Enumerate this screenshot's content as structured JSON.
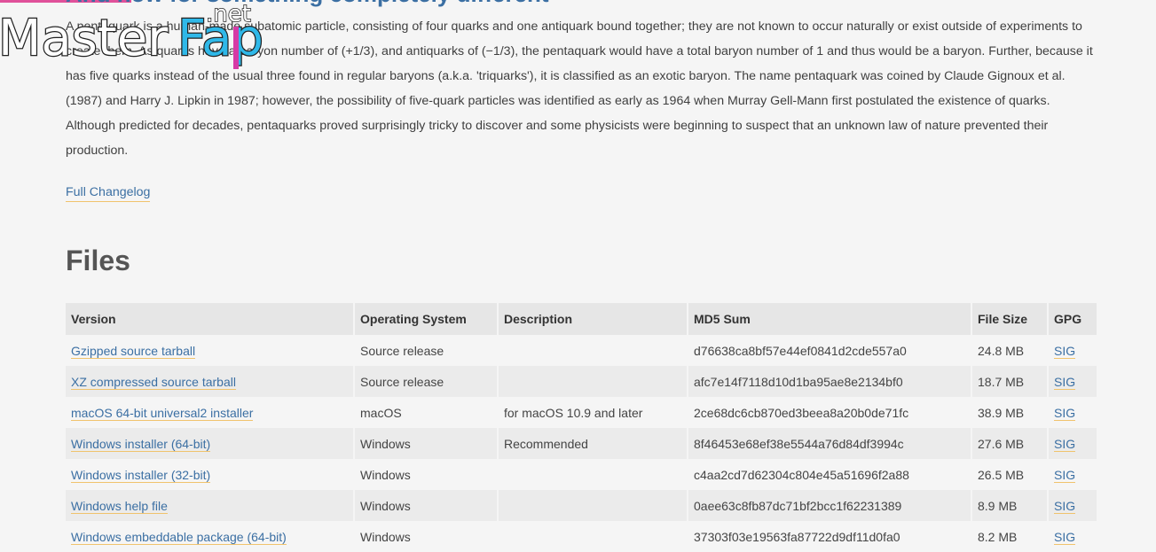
{
  "heading": "And now for something completely different",
  "intro": "A pentaquark is a human-made subatomic particle, consisting of four quarks and one antiquark bound together; they are not known to occur naturally or exist outside of experiments to create them. As quarks have a baryon number of (+1/3), and antiquarks of (−1/3), the pentaquark would have a total baryon number of 1 and thus would be a baryon. Further, because it has five quarks instead of the usual three found in regular baryons (a.k.a. 'triquarks'), it is classified as an exotic baryon. The name pentaquark was coined by Claude Gignoux et al. (1987) and Harry J. Lipkin in 1987; however, the possibility of five-quark particles was identified as early as 1964 when Murray Gell-Mann first postulated the existence of quarks. Although predicted for decades, pentaquarks proved surprisingly tricky to discover and some physicists were beginning to suspect that an unknown law of nature prevented their production.",
  "changelog_label": "Full Changelog",
  "files_title": "Files",
  "watermark": {
    "text_main": "MasterFap",
    "text_sub": ".net"
  },
  "table": {
    "headers": {
      "version": "Version",
      "os": "Operating System",
      "description": "Description",
      "md5": "MD5 Sum",
      "size": "File Size",
      "gpg": "GPG"
    },
    "rows": [
      {
        "version": "Gzipped source tarball",
        "os": "Source release",
        "description": "",
        "md5": "d76638ca8bf57e44ef0841d2cde557a0",
        "size": "24.8 MB",
        "gpg": "SIG"
      },
      {
        "version": "XZ compressed source tarball",
        "os": "Source release",
        "description": "",
        "md5": "afc7e14f7118d10d1ba95ae8e2134bf0",
        "size": "18.7 MB",
        "gpg": "SIG"
      },
      {
        "version": "macOS 64-bit universal2 installer",
        "os": "macOS",
        "description": "for macOS 10.9 and later",
        "md5": "2ce68dc6cb870ed3beea8a20b0de71fc",
        "size": "38.9 MB",
        "gpg": "SIG"
      },
      {
        "version": "Windows installer (64-bit)",
        "os": "Windows",
        "description": "Recommended",
        "md5": "8f46453e68ef38e5544a76d84df3994c",
        "size": "27.6 MB",
        "gpg": "SIG"
      },
      {
        "version": "Windows installer (32-bit)",
        "os": "Windows",
        "description": "",
        "md5": "c4aa2cd7d62304c804e45a51696f2a88",
        "size": "26.5 MB",
        "gpg": "SIG"
      },
      {
        "version": "Windows help file",
        "os": "Windows",
        "description": "",
        "md5": "0aee63c8fb87dc71bf2bcc1f62231389",
        "size": "8.9 MB",
        "gpg": "SIG"
      },
      {
        "version": "Windows embeddable package (64-bit)",
        "os": "Windows",
        "description": "",
        "md5": "37303f03e19563fa87722d9df11d0fa0",
        "size": "8.2 MB",
        "gpg": "SIG"
      }
    ]
  }
}
